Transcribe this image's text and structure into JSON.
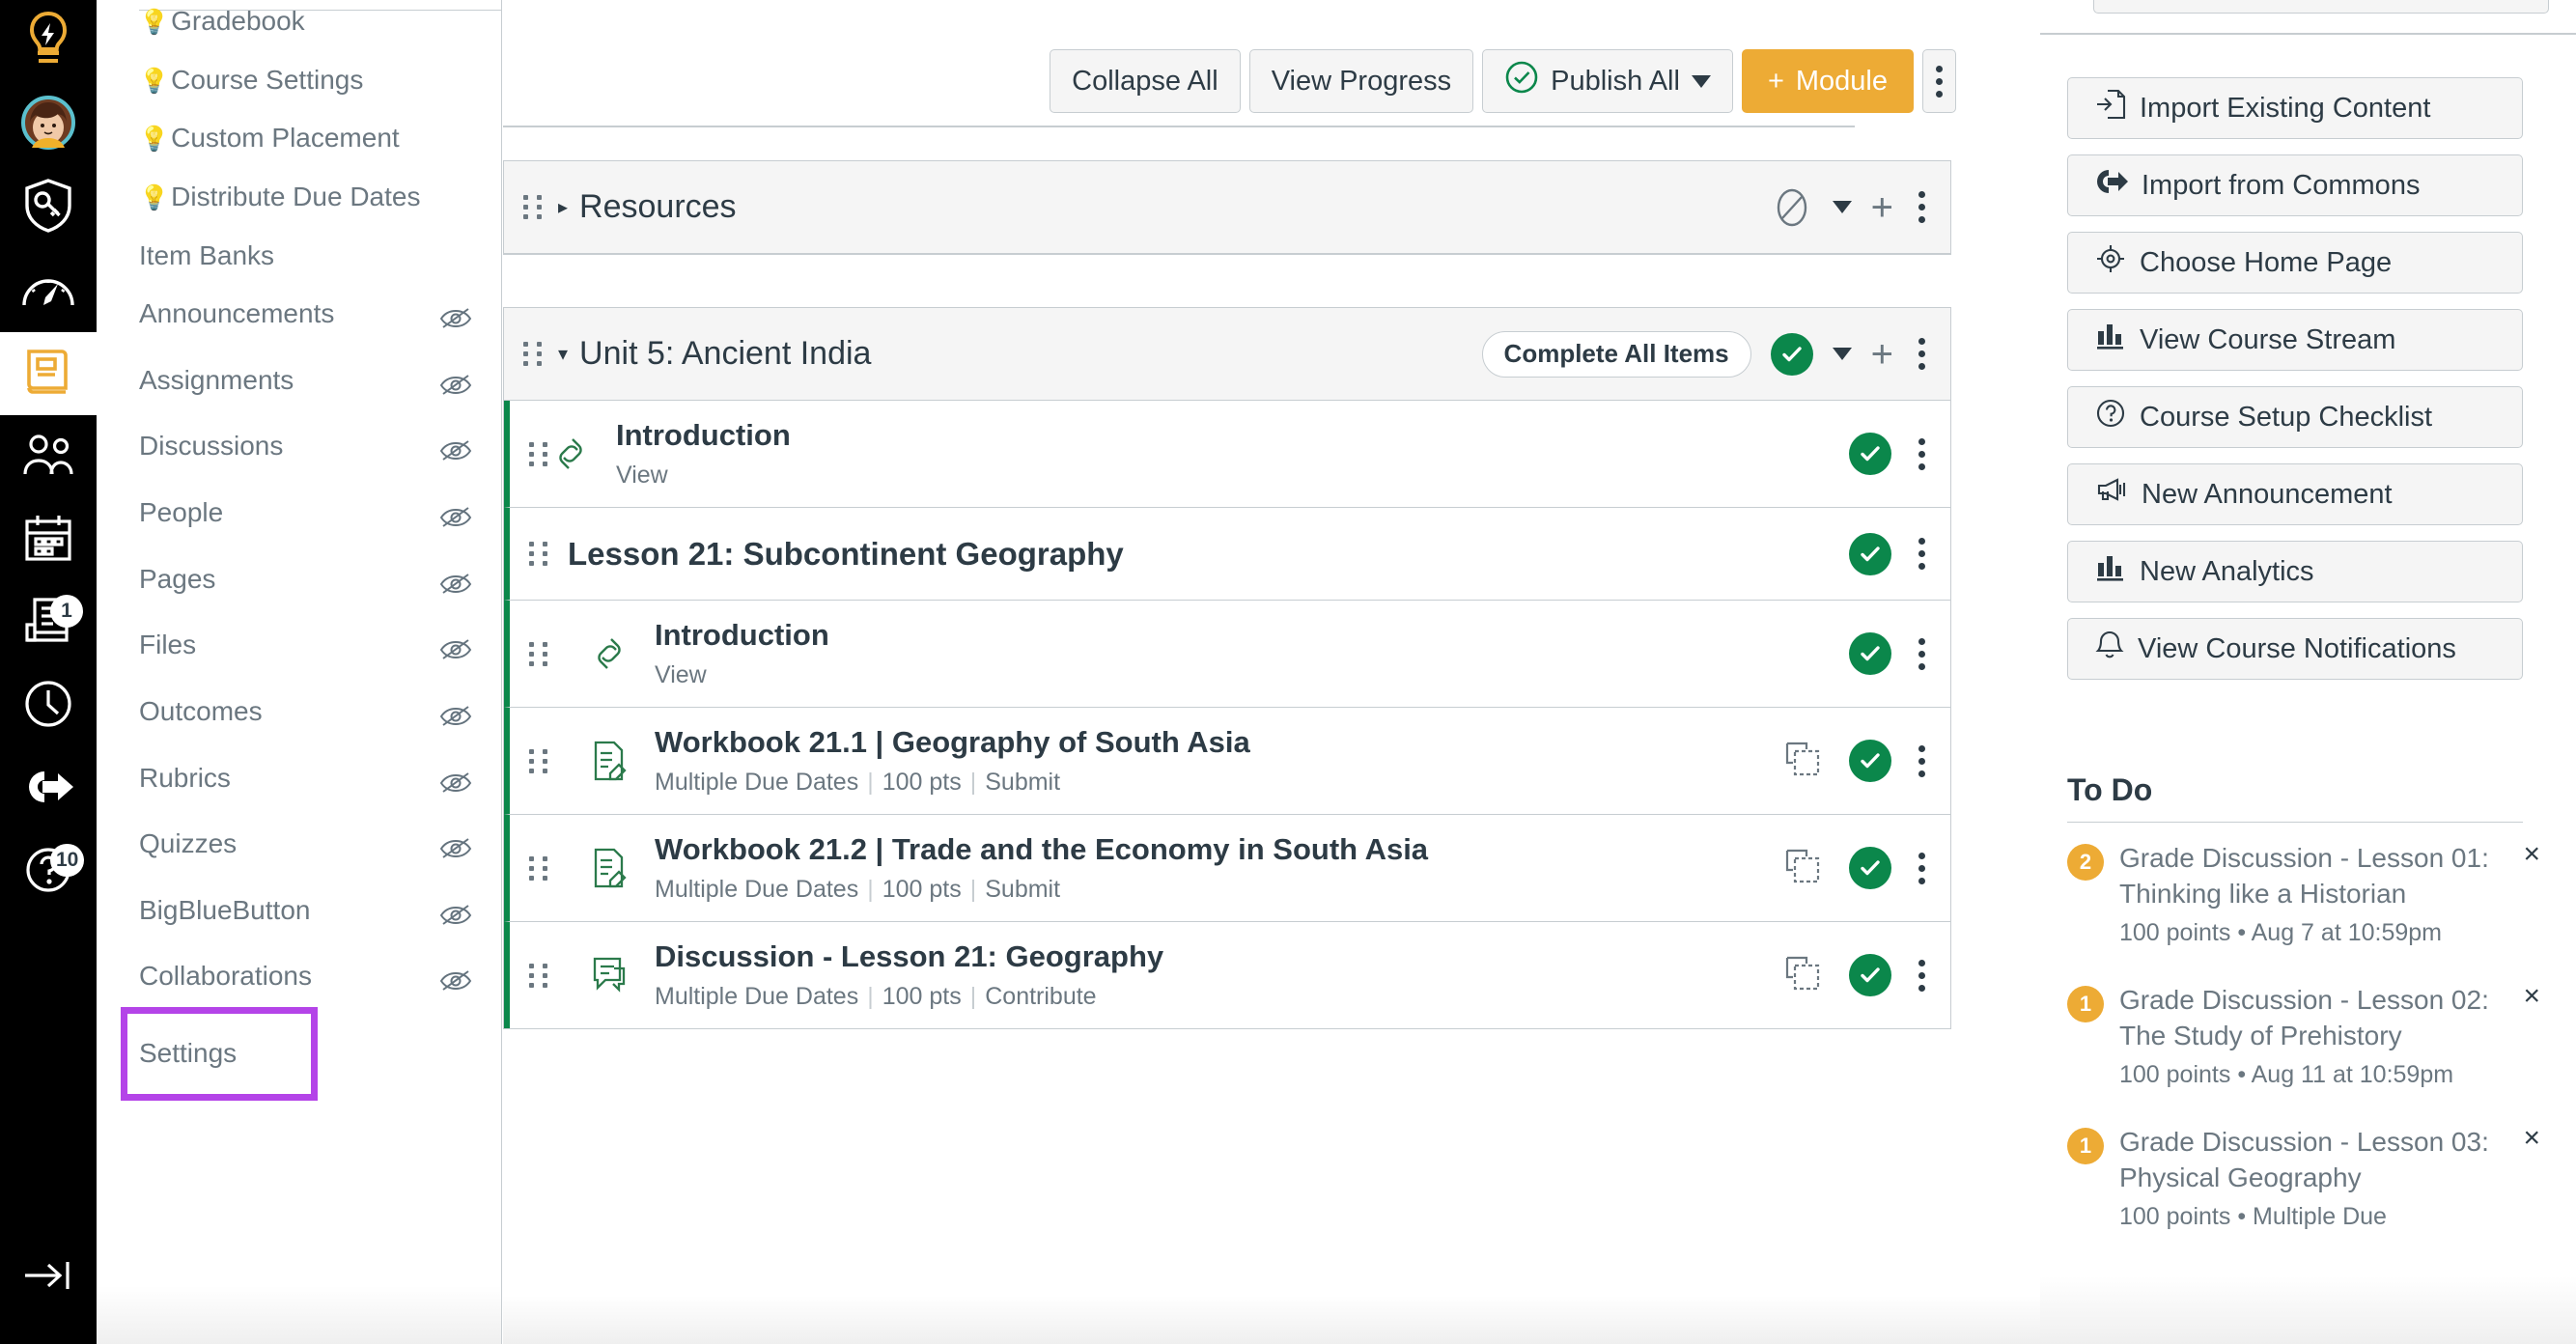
{
  "global_nav": {
    "items": [
      {
        "name": "dashboard-lightbulb",
        "icon": "lightbulb-icon",
        "badge": null,
        "active": false
      },
      {
        "name": "account-avatar",
        "icon": "avatar-icon",
        "badge": null,
        "active": false
      },
      {
        "name": "admin",
        "icon": "shield-key-icon",
        "badge": null,
        "active": false
      },
      {
        "name": "dashboard",
        "icon": "gauge-icon",
        "badge": null,
        "active": false
      },
      {
        "name": "courses",
        "icon": "book-icon",
        "badge": null,
        "active": true
      },
      {
        "name": "groups",
        "icon": "people-icon",
        "badge": null,
        "active": false
      },
      {
        "name": "calendar",
        "icon": "calendar-icon",
        "badge": null,
        "active": false
      },
      {
        "name": "inbox",
        "icon": "inbox-icon",
        "badge": "1",
        "active": false
      },
      {
        "name": "history",
        "icon": "clock-icon",
        "badge": null,
        "active": false
      },
      {
        "name": "commons",
        "icon": "export-arrow-icon",
        "badge": null,
        "active": false
      },
      {
        "name": "help",
        "icon": "question-icon",
        "badge": "10",
        "active": false
      }
    ],
    "collapse_label": "Minimize Global Navigation"
  },
  "course_nav": {
    "items": [
      {
        "label": "Gradebook",
        "bulb": true,
        "hidden": false,
        "clipped": true
      },
      {
        "label": "Course Settings",
        "bulb": true,
        "hidden": false
      },
      {
        "label": "Custom Placement",
        "bulb": true,
        "hidden": false
      },
      {
        "label": "Distribute Due Dates",
        "bulb": true,
        "hidden": false
      },
      {
        "label": "Item Banks",
        "bulb": false,
        "hidden": false
      },
      {
        "label": "Announcements",
        "bulb": false,
        "hidden": true
      },
      {
        "label": "Assignments",
        "bulb": false,
        "hidden": true
      },
      {
        "label": "Discussions",
        "bulb": false,
        "hidden": true
      },
      {
        "label": "People",
        "bulb": false,
        "hidden": true
      },
      {
        "label": "Pages",
        "bulb": false,
        "hidden": true
      },
      {
        "label": "Files",
        "bulb": false,
        "hidden": true
      },
      {
        "label": "Outcomes",
        "bulb": false,
        "hidden": true
      },
      {
        "label": "Rubrics",
        "bulb": false,
        "hidden": true
      },
      {
        "label": "Quizzes",
        "bulb": false,
        "hidden": true
      },
      {
        "label": "BigBlueButton",
        "bulb": false,
        "hidden": true
      },
      {
        "label": "Collaborations",
        "bulb": false,
        "hidden": true
      },
      {
        "label": "Settings",
        "bulb": false,
        "hidden": false,
        "highlighted": true
      }
    ]
  },
  "toolbar": {
    "collapse_all": "Collapse All",
    "view_progress": "View Progress",
    "publish_all": "Publish All",
    "add_module": "Module",
    "add_module_plus": "+",
    "kebab_label": "Modules Options"
  },
  "modules": [
    {
      "title": "Resources",
      "collapsed": true,
      "published": false,
      "publish_state_icon": "unpublish-circle-icon",
      "complete_pill": null,
      "items": []
    },
    {
      "title": "Unit 5: Ancient India",
      "collapsed": false,
      "published": true,
      "publish_state_icon": "publish-check-icon",
      "complete_pill": "Complete All Items",
      "items": [
        {
          "title": "Introduction",
          "type": "link",
          "icon": "link-icon",
          "indent": 0,
          "meta": [],
          "action": "View",
          "published": true,
          "has_duplicate": false
        },
        {
          "title": "Lesson 21: Subcontinent Geography",
          "type": "subheader",
          "icon": null,
          "indent": 0,
          "meta": [],
          "action": null,
          "published": true,
          "has_duplicate": false
        },
        {
          "title": "Introduction",
          "type": "link",
          "icon": "link-icon",
          "indent": 1,
          "meta": [],
          "action": "View",
          "published": true,
          "has_duplicate": false
        },
        {
          "title": "Workbook 21.1 | Geography of South Asia",
          "type": "assignment",
          "icon": "assignment-icon",
          "indent": 1,
          "meta": [
            "Multiple Due Dates",
            "100 pts",
            "Submit"
          ],
          "action": null,
          "published": true,
          "has_duplicate": true
        },
        {
          "title": "Workbook 21.2 | Trade and the Economy in South Asia",
          "type": "assignment",
          "icon": "assignment-icon",
          "indent": 1,
          "meta": [
            "Multiple Due Dates",
            "100 pts",
            "Submit"
          ],
          "action": null,
          "published": true,
          "has_duplicate": true
        },
        {
          "title": "Discussion - Lesson 21: Geography",
          "type": "discussion",
          "icon": "discussion-icon",
          "indent": 1,
          "meta": [
            "Multiple Due Dates",
            "100 pts",
            "Contribute"
          ],
          "action": null,
          "published": true,
          "has_duplicate": true
        }
      ]
    }
  ],
  "right_sidebar": {
    "buttons": [
      {
        "label": "Import Existing Content",
        "icon": "import-document-icon"
      },
      {
        "label": "Import from Commons",
        "icon": "commons-icon"
      },
      {
        "label": "Choose Home Page",
        "icon": "target-icon"
      },
      {
        "label": "View Course Stream",
        "icon": "bar-chart-icon"
      },
      {
        "label": "Course Setup Checklist",
        "icon": "question-circle-icon"
      },
      {
        "label": "New Announcement",
        "icon": "megaphone-icon"
      },
      {
        "label": "New Analytics",
        "icon": "bar-chart-icon"
      },
      {
        "label": "View Course Notifications",
        "icon": "bell-icon"
      }
    ],
    "todo": {
      "title": "To Do",
      "items": [
        {
          "count": "2",
          "label": "Grade Discussion - Lesson 01: Thinking like a Historian",
          "meta": "100 points • Aug 7 at 10:59pm",
          "dismiss": "×"
        },
        {
          "count": "1",
          "label": "Grade Discussion - Lesson 02: The Study of Prehistory",
          "meta": "100 points • Aug 11 at 10:59pm",
          "dismiss": "×"
        },
        {
          "count": "1",
          "label": "Grade Discussion - Lesson 03: Physical Geography",
          "meta": "100 points • Multiple Due",
          "dismiss": "×"
        }
      ]
    }
  },
  "colors": {
    "brand_gold": "#edab35",
    "publish_green": "#0b874b",
    "highlight_purple": "#b444e8",
    "text_dark": "#2d3b45",
    "text_muted": "#6b7780",
    "border": "#c7cdd1"
  }
}
